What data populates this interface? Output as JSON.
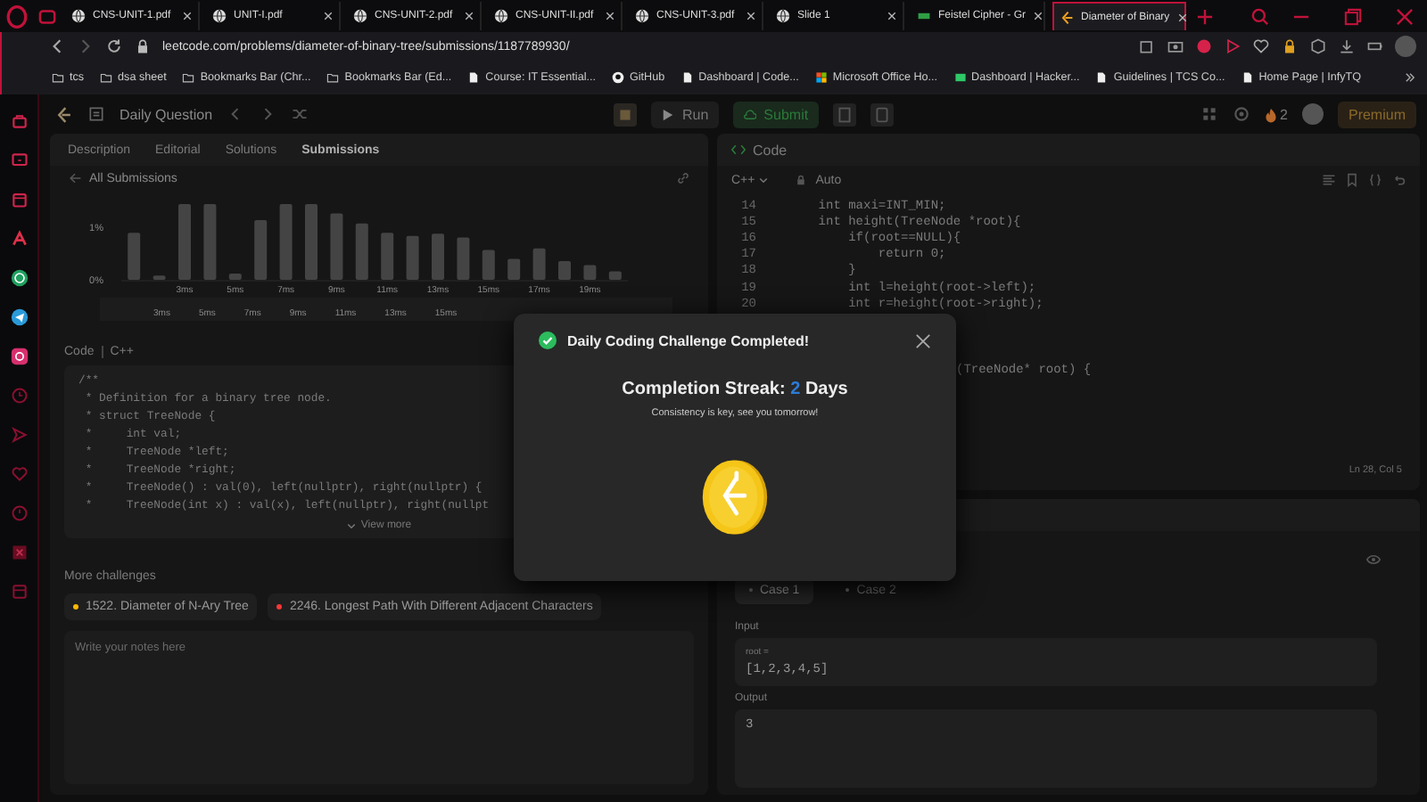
{
  "browser": {
    "tabs": [
      {
        "title": "CNS-UNIT-1.pdf",
        "selected": false,
        "kind": "globe"
      },
      {
        "title": "UNIT-I.pdf",
        "selected": false,
        "kind": "globe"
      },
      {
        "title": "CNS-UNIT-2.pdf",
        "selected": false,
        "kind": "globe"
      },
      {
        "title": "CNS-UNIT-II.pdf",
        "selected": false,
        "kind": "globe"
      },
      {
        "title": "CNS-UNIT-3.pdf",
        "selected": false,
        "kind": "globe"
      },
      {
        "title": "Slide 1",
        "selected": false,
        "kind": "globe"
      },
      {
        "title": "Feistel Cipher - Gr",
        "selected": false,
        "kind": "site"
      },
      {
        "title": "Diameter of Binary",
        "selected": true,
        "kind": "leetcode"
      }
    ],
    "url": "leetcode.com/problems/diameter-of-binary-tree/submissions/1187789930/",
    "bookmarks": [
      {
        "label": "tcs",
        "kind": "folder"
      },
      {
        "label": "dsa sheet",
        "kind": "folder"
      },
      {
        "label": "Bookmarks Bar (Chr...",
        "kind": "folder"
      },
      {
        "label": "Bookmarks Bar (Ed...",
        "kind": "folder"
      },
      {
        "label": "Course: IT Essential...",
        "kind": "page"
      },
      {
        "label": "GitHub",
        "kind": "github"
      },
      {
        "label": "Dashboard | Code...",
        "kind": "page"
      },
      {
        "label": "Microsoft Office Ho...",
        "kind": "office"
      },
      {
        "label": "Dashboard | Hacker...",
        "kind": "hacker"
      },
      {
        "label": "Guidelines | TCS Co...",
        "kind": "page"
      },
      {
        "label": "Home Page | InfyTQ",
        "kind": "page"
      }
    ]
  },
  "nav": {
    "title": "Daily Question",
    "run": "Run",
    "submit": "Submit",
    "streak": "2",
    "premium": "Premium"
  },
  "left": {
    "tabs": [
      {
        "label": "Description",
        "selected": false
      },
      {
        "label": "Editorial",
        "selected": false
      },
      {
        "label": "Solutions",
        "selected": false
      },
      {
        "label": "Submissions",
        "selected": true
      }
    ],
    "back_label": "All Submissions",
    "chart_data": {
      "type": "bar",
      "x": [
        1,
        2,
        3,
        4,
        5,
        6,
        7,
        8,
        9,
        10,
        11,
        12,
        13,
        14,
        15,
        16,
        17,
        18,
        19,
        20
      ],
      "values": [
        0.9,
        0.08,
        1.45,
        1.45,
        0.12,
        1.14,
        1.45,
        1.45,
        1.27,
        1.08,
        0.9,
        0.84,
        0.88,
        0.81,
        0.57,
        0.4,
        0.6,
        0.36,
        0.28,
        0.16
      ],
      "xticks": [
        {
          "value": 3,
          "label": "3ms"
        },
        {
          "value": 5,
          "label": "5ms"
        },
        {
          "value": 7,
          "label": "7ms"
        },
        {
          "value": 9,
          "label": "9ms"
        },
        {
          "value": 11,
          "label": "11ms"
        },
        {
          "value": 13,
          "label": "13ms"
        },
        {
          "value": 15,
          "label": "15ms"
        },
        {
          "value": 17,
          "label": "17ms"
        },
        {
          "value": 19,
          "label": "19ms"
        }
      ],
      "yticks": [
        {
          "value": 0,
          "label": "0%"
        },
        {
          "value": 1,
          "label": "1%"
        }
      ],
      "xlim": [
        0.5,
        20.5
      ],
      "ylim": [
        0,
        1.5
      ]
    },
    "overview_labels": [
      "3ms",
      "5ms",
      "7ms",
      "9ms",
      "11ms",
      "13ms",
      "15ms"
    ],
    "code_label": "Code",
    "language": "C++",
    "code_lines": [
      "/**",
      " * Definition for a binary tree node.",
      " * struct TreeNode {",
      " *     int val;",
      " *     TreeNode *left;",
      " *     TreeNode *right;",
      " *     TreeNode() : val(0), left(nullptr), right(nullptr) {",
      " *     TreeNode(int x) : val(x), left(nullptr), right(nullpt"
    ],
    "view_more": "View more",
    "more_title": "More challenges",
    "challenges": [
      {
        "title": "1522. Diameter of N-Ary Tree",
        "color": "#ffb800"
      },
      {
        "title": "2246. Longest Path With Different Adjacent Characters",
        "color": "#f63737"
      }
    ],
    "notes_placeholder": "Write your notes here"
  },
  "editor": {
    "title": "Code",
    "language": "C++",
    "mode": "Auto",
    "lines": [
      {
        "kind": "full",
        "number": "14",
        "text": "    int maxi=INT_MIN;"
      },
      {
        "kind": "full",
        "number": "15",
        "text": "    int height(TreeNode *root){"
      },
      {
        "kind": "full",
        "number": "16",
        "text": "        if(root==NULL){"
      },
      {
        "kind": "full",
        "number": "17",
        "text": "            return 0;"
      },
      {
        "kind": "full",
        "number": "18",
        "text": "        }"
      },
      {
        "kind": "full",
        "number": "19",
        "text": "        int l=height(root->left);"
      },
      {
        "kind": "full",
        "number": "20",
        "text": "        int r=height(root->right);"
      },
      {
        "kind": "partial",
        "text": "(TreeNode* root) {"
      }
    ],
    "cursor": "Ln 28, Col 5"
  },
  "testcase": {
    "cases": [
      {
        "label": "Case 1",
        "selected": true
      },
      {
        "label": "Case 2",
        "selected": false
      }
    ],
    "input_label": "Input",
    "param": "root =",
    "input": "[1,2,3,4,5]",
    "output_label": "Output",
    "output": "3"
  },
  "modal": {
    "title": "Daily Coding Challenge Completed!",
    "streak_label": "Completion Streak:",
    "streak": "2",
    "streak_unit": "Days",
    "message": "Consistency is key, see you tomorrow!"
  }
}
